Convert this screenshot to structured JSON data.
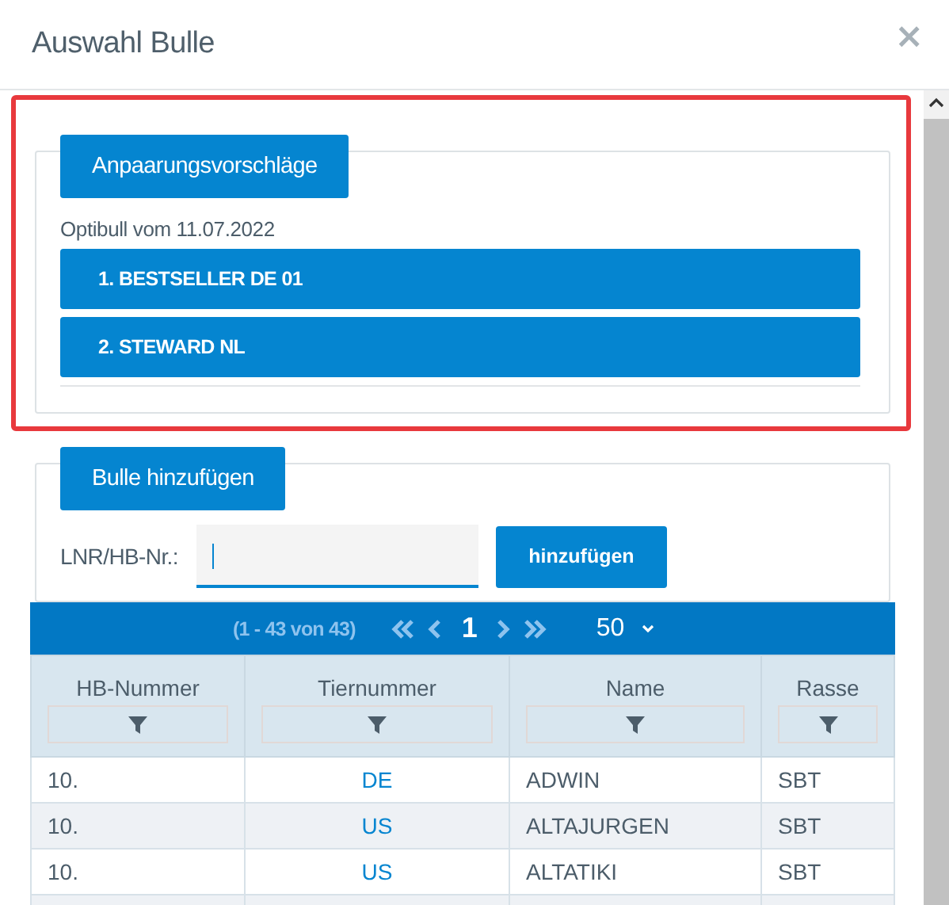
{
  "dialog": {
    "title": "Auswahl Bulle",
    "close": "×"
  },
  "suggestions": {
    "legend": "Anpaarungsvorschläge",
    "source": "Optibull vom 11.07.2022",
    "items": [
      "1. BESTSELLER DE 01",
      "2. STEWARD NL"
    ]
  },
  "add": {
    "legend": "Bulle hinzufügen",
    "label": "LNR/HB-Nr.:",
    "input": {
      "focused": true
    },
    "button": "hinzufügen"
  },
  "pager": {
    "range": "(1 - 43 von 43)",
    "page": "1",
    "page_size": "50"
  },
  "table": {
    "columns": [
      "HB-Nummer",
      "Tiernummer",
      "Name",
      "Rasse"
    ],
    "rows": [
      [
        "10.",
        "DE",
        "ADWIN",
        "SBT"
      ],
      [
        "10.",
        "US",
        "ALTAJURGEN",
        "SBT"
      ],
      [
        "10.",
        "US",
        "ALTATIKI",
        "SBT"
      ]
    ]
  }
}
